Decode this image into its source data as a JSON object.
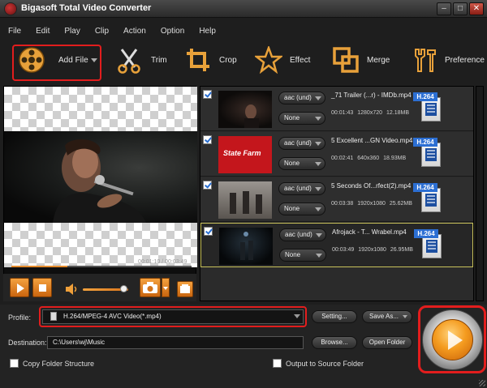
{
  "window": {
    "title": "Bigasoft Total Video Converter"
  },
  "menu": [
    "File",
    "Edit",
    "Play",
    "Clip",
    "Action",
    "Option",
    "Help"
  ],
  "toolbar": {
    "add_file": "Add File",
    "trim": "Trim",
    "crop": "Crop",
    "effect": "Effect",
    "merge": "Merge",
    "preference": "Preference"
  },
  "player": {
    "time": "00:01:10 / 00:03:49",
    "progress": 0.31,
    "volume": 0.9
  },
  "files": [
    {
      "name": "_71 Trailer (...r) - IMDb.mp4",
      "duration": "00:01:43",
      "resolution": "1280x720",
      "size": "12.18MB",
      "audio": "aac (und)",
      "subtitle": "None",
      "codec": "H.264"
    },
    {
      "name": "5 Excellent ...GN Video.mp4",
      "duration": "00:02:41",
      "resolution": "640x360",
      "size": "18.93MB",
      "audio": "aac (und)",
      "subtitle": "None",
      "codec": "H.264",
      "thumb_text": "State Farm"
    },
    {
      "name": "5 Seconds Of...rfect(2).mp4",
      "duration": "00:03:38",
      "resolution": "1920x1080",
      "size": "25.62MB",
      "audio": "aac (und)",
      "subtitle": "None",
      "codec": "H.264"
    },
    {
      "name": "Afrojack - T... Wrabel.mp4",
      "duration": "00:03:49",
      "resolution": "1920x1080",
      "size": "26.95MB",
      "audio": "aac (und)",
      "subtitle": "None",
      "codec": "H.264"
    }
  ],
  "profile": {
    "label": "Profile:",
    "value": "H.264/MPEG-4 AVC Video(*.mp4)",
    "setting": "Setting...",
    "save_as": "Save As..."
  },
  "destination": {
    "label": "Destination:",
    "value": "C:\\Users\\wj\\Music",
    "browse": "Browse...",
    "open_folder": "Open Folder"
  },
  "options": {
    "copy_folder": "Copy Folder Structure",
    "output_source": "Output to Source Folder"
  },
  "colors": {
    "accent": "#f49b1f",
    "highlight": "#e21d1d",
    "codec_badge": "#2c6fd3"
  }
}
